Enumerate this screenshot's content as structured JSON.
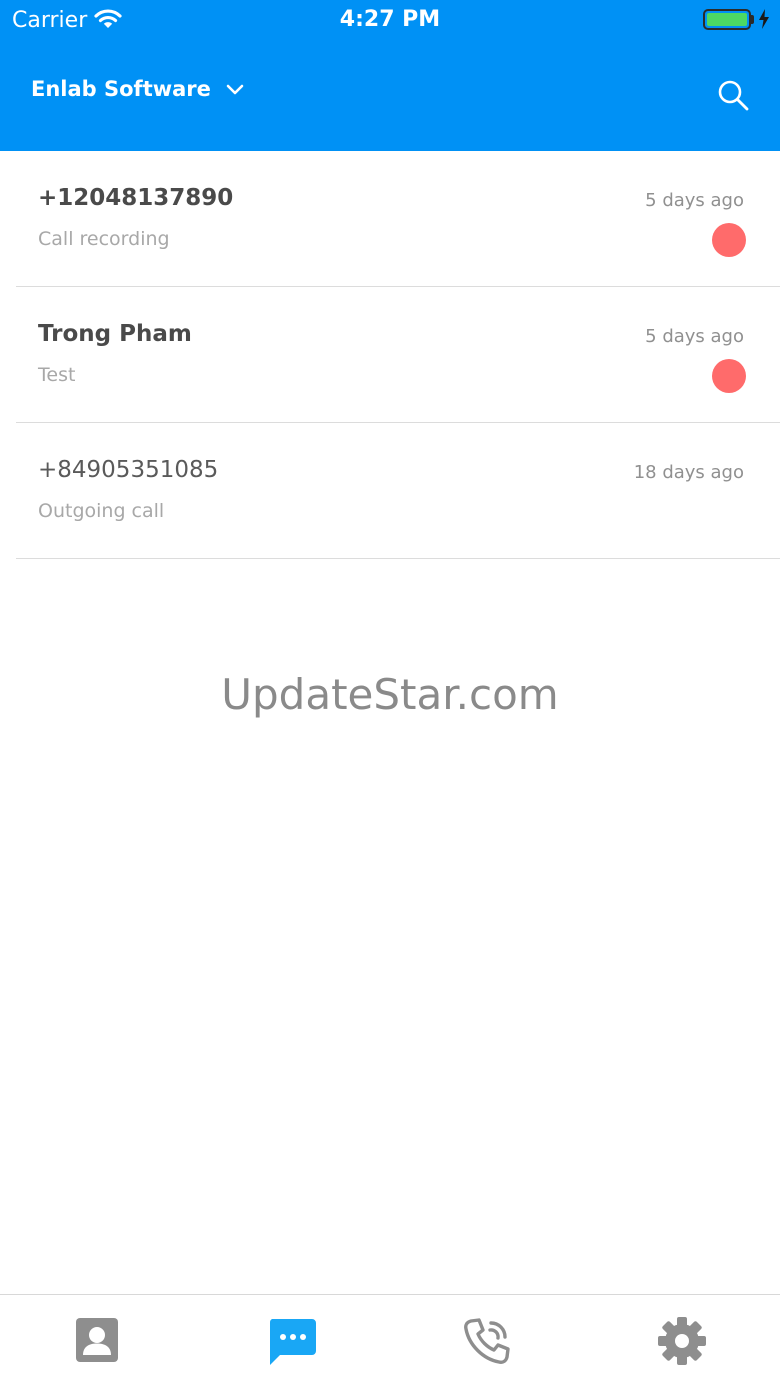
{
  "status_bar": {
    "carrier": "Carrier",
    "time": "4:27 PM"
  },
  "header": {
    "org_name": "Enlab Software"
  },
  "conversations": [
    {
      "title": "+12048137890",
      "subtitle": "Call recording",
      "time": "5 days ago",
      "unread": true
    },
    {
      "title": "Trong Pham",
      "subtitle": "Test",
      "time": "5 days ago",
      "unread": true
    },
    {
      "title": "+84905351085",
      "subtitle": "Outgoing call",
      "time": "18 days ago",
      "unread": false
    }
  ],
  "watermark": "UpdateStar.com",
  "tabs": [
    {
      "icon": "contacts-icon",
      "active": false
    },
    {
      "icon": "messages-icon",
      "active": true
    },
    {
      "icon": "calls-icon",
      "active": false
    },
    {
      "icon": "settings-icon",
      "active": false
    }
  ],
  "colors": {
    "brand": "#0091f5",
    "active_tab": "#19a7f5",
    "inactive_tab": "#8e8e8e",
    "unread_dot": "#ff6b6b"
  }
}
